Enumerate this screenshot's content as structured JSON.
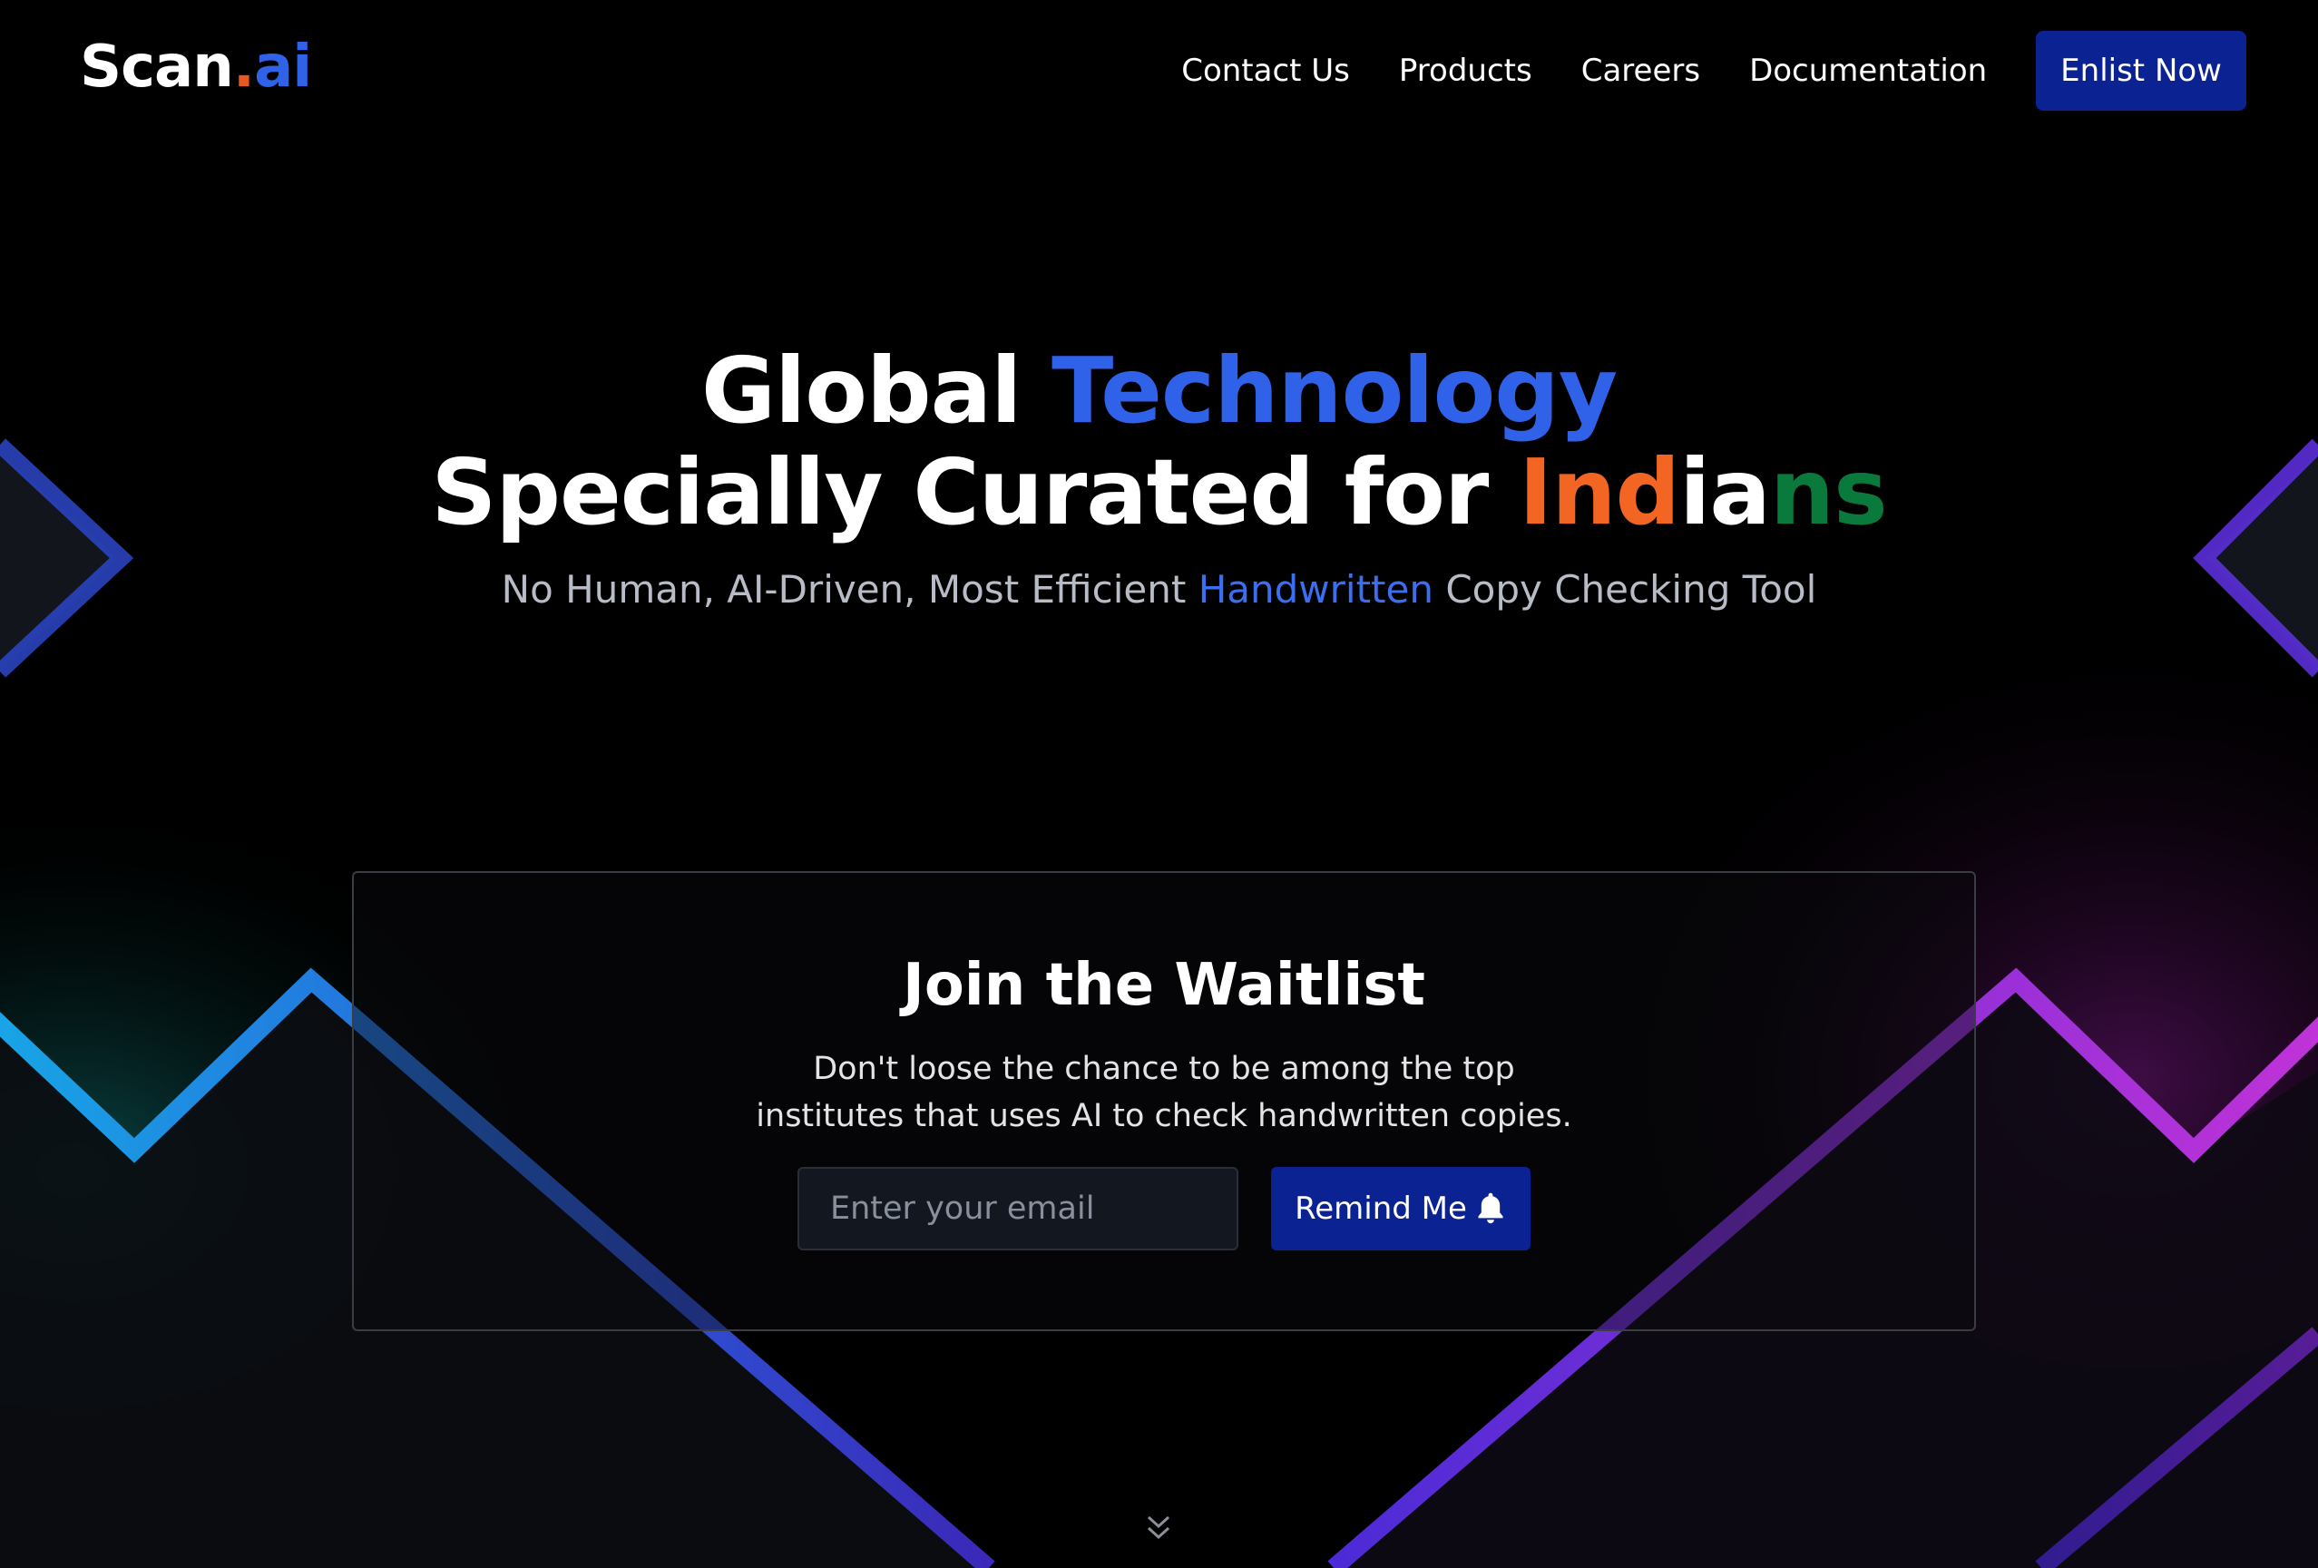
{
  "header": {
    "logo": {
      "name": "Scan",
      "dot": ".",
      "suffix": "ai"
    },
    "nav": [
      "Contact Us",
      "Products",
      "Careers",
      "Documentation"
    ],
    "cta": "Enlist Now"
  },
  "hero": {
    "line1": {
      "plain": "Global ",
      "accent": "Technology"
    },
    "line2": {
      "plain": "Specially Curated for ",
      "saffron": "Ind",
      "white": "ia",
      "green": "ns"
    },
    "subtitle": {
      "before": "No Human, AI-Driven, Most Efficient ",
      "accent": "Handwritten",
      "after": " Copy Checking Tool"
    }
  },
  "waitlist": {
    "title": "Join the Waitlist",
    "description": "Don't loose the chance to be among the top institutes that uses AI to check handwritten copies.",
    "email_placeholder": "Enter your email",
    "email_value": "",
    "button_label": "Remind Me",
    "button_icon": "bell-icon"
  },
  "footer": {
    "scroll_icon": "double-chevron-down-icon"
  },
  "colors": {
    "background": "#000000",
    "brand_blue": "#2f62e8",
    "button_blue": "#0b2293",
    "saffron": "#f26522",
    "green": "#0a7a3c"
  }
}
